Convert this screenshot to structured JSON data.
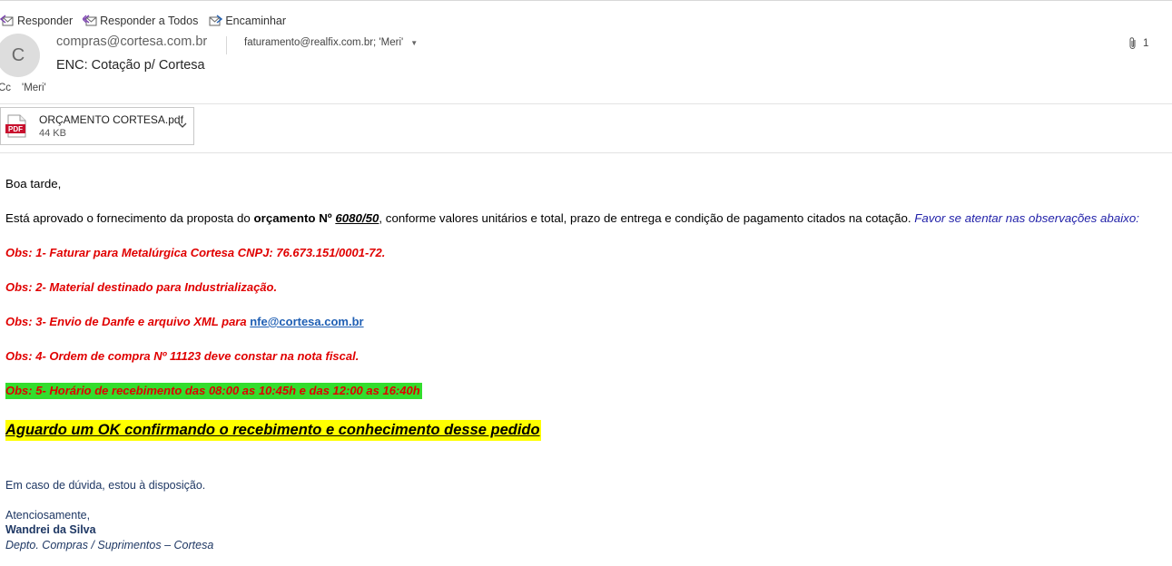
{
  "toolbar": {
    "reply": "Responder",
    "reply_all": "Responder a Todos",
    "forward": "Encaminhar"
  },
  "header": {
    "avatar_initial": "C",
    "from": "compras@cortesa.com.br",
    "to": "faturamento@realfix.com.br; 'Meri'",
    "subject": "ENC: Cotação p/ Cortesa",
    "attachment_count": "1",
    "cc_label": "Cc",
    "cc_value": "'Meri'"
  },
  "attachment": {
    "icon_label": "PDF",
    "name": "ORÇAMENTO CORTESA.pdf",
    "size": "44 KB"
  },
  "message": {
    "greeting": "Boa tarde,",
    "p1_start": "Está aprovado o fornecimento da proposta do ",
    "p1_bold": "orçamento Nº ",
    "p1_number": "6080/50",
    "p1_rest": ", conforme valores unitários e total, prazo de entrega e condição de pagamento citados na cotação. ",
    "p1_note": "Favor se atentar nas observações abaixo:",
    "obs1": "Obs: 1- Faturar para Metalúrgica Cortesa CNPJ: 76.673.151/0001-72.",
    "obs2": "Obs: 2- Material destinado para Industrialização.",
    "obs3_text": "Obs: 3- Envio de Danfe e arquivo XML para ",
    "obs3_link": "nfe@cortesa.com.br",
    "obs4": "Obs: 4- Ordem de compra Nº  11123  deve constar na nota fiscal.",
    "obs5": "Obs: 5- Horário de recebimento das 08:00 as 10:45h e das 12:00 as 16:40h",
    "highlight": "Aguardo um OK confirmando o recebimento e conhecimento desse pedido",
    "doubt": "Em caso de dúvida, estou à disposição.",
    "closing": "Atenciosamente,",
    "sig_name": "Wandrei da Silva",
    "sig_dept": "Depto. Compras / Suprimentos – Cortesa"
  },
  "colors": {
    "obs_red": "#e00000",
    "link_blue": "#1f5fb4",
    "note_blue": "#1f1fa8",
    "highlight_green": "#33dd2d",
    "highlight_yellow": "#ffff00",
    "signature_navy": "#1f3864"
  }
}
